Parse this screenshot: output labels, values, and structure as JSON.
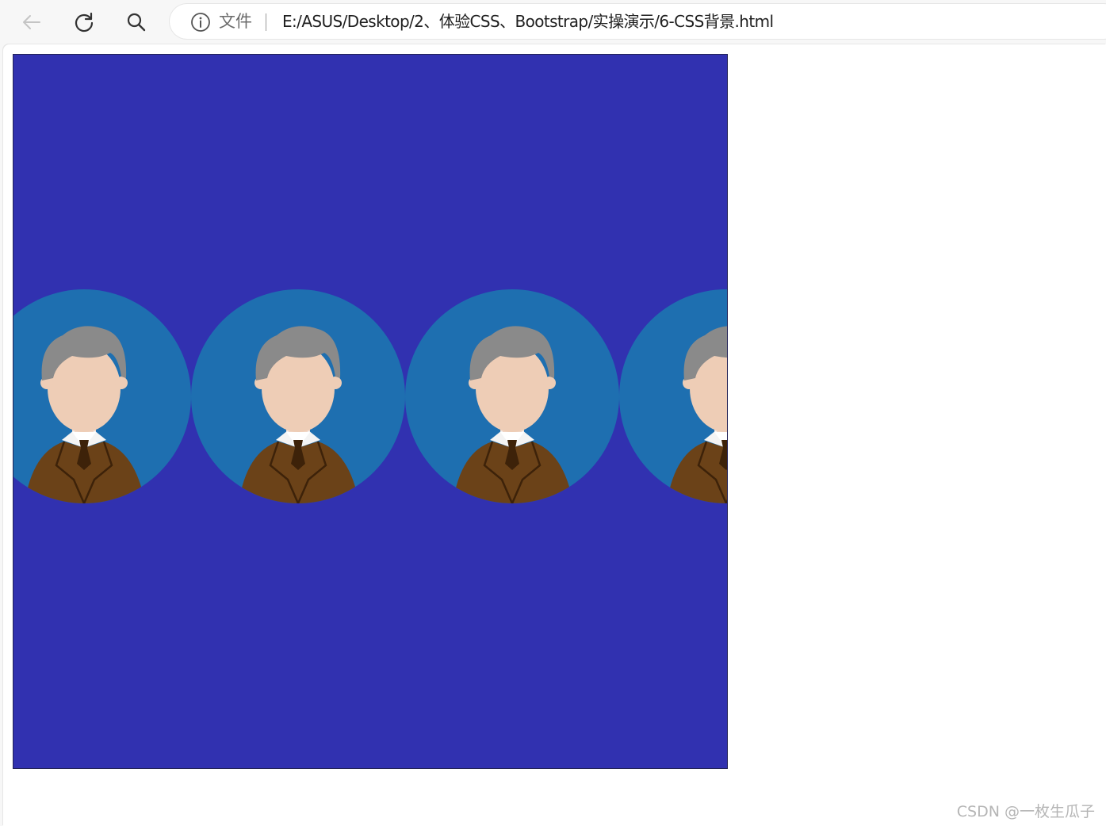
{
  "browser": {
    "address_label": "文件",
    "url": "E:/ASUS/Desktop/2、体验CSS、Bootstrap/实操演示/6-CSS背景.html",
    "icons": [
      "back-arrow-icon",
      "reload-icon",
      "search-icon",
      "info-icon"
    ]
  },
  "page": {
    "demo_box": {
      "background_color": "#3131b0",
      "tile_circle_color": "#1e6fb0",
      "avatar_count_visible": 3
    }
  },
  "watermark": "CSDN @一枚生瓜子"
}
